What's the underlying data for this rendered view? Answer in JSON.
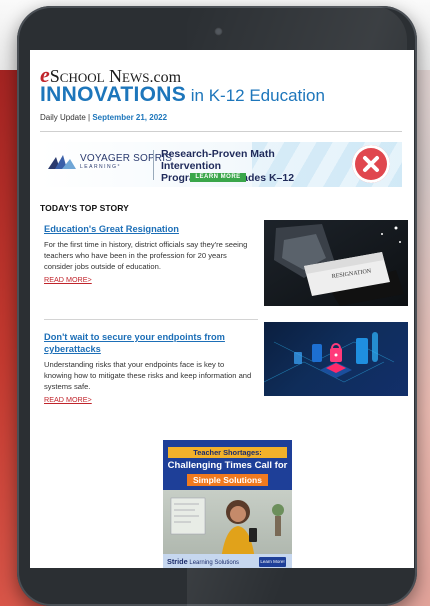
{
  "header": {
    "brand_e": "e",
    "brand_rest": "School News",
    "brand_tld": ".com",
    "title_main": "INNOVATIONS",
    "title_sub": " in K-12 Education",
    "dateline_label": "Daily Update | ",
    "dateline_date": "September 21, 2022"
  },
  "ad_banner": {
    "logo_name": "VOYAGER SOPRIS",
    "logo_tag": "LEARNING°",
    "message_line1": "Research-Proven Math Intervention",
    "message_line2": "Programs for Grades K–12",
    "cta": "LEARN MORE",
    "badge_icon": "x-icon"
  },
  "section_title": "TODAY'S TOP STORY",
  "stories": [
    {
      "title": "Education's Great Resignation",
      "body": "For the first time in history, district officials say they're seeing teachers who have been in the profession for 20 years consider jobs outside of education.",
      "more": "READ MORE>",
      "image_icon": "resignation-letter-photo"
    },
    {
      "title": "Don't wait to secure your endpoints from cyberattacks",
      "body": "Understanding risks that your endpoints face is key to knowing how to mitigate these risks and keep information and systems safe.",
      "more": "READ MORE>",
      "image_icon": "cyber-security-lock-illustration"
    }
  ],
  "promo": {
    "line1": "Teacher Shortages:",
    "line2": "Challenging Times Call for",
    "line3": "Simple Solutions",
    "brand": "Stride",
    "brand_sub": " Learning Solutions",
    "cta": "Learn More!"
  },
  "colors": {
    "accent": "#1d76bb",
    "read_more": "#c0242b",
    "brand_red": "#c0242b",
    "promo_bg": "#1e3f98"
  }
}
